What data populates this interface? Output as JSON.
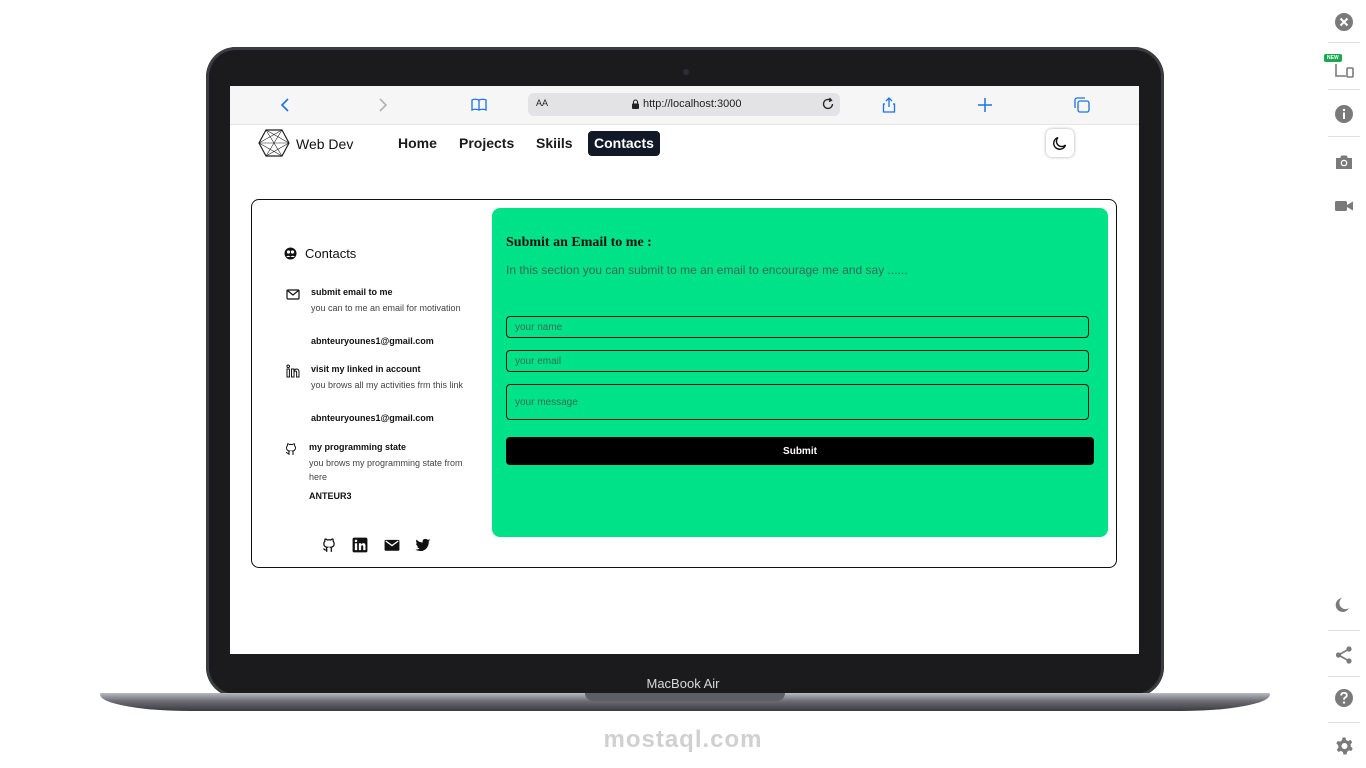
{
  "browser": {
    "url_aa": "AA",
    "url": "http://localhost:3000"
  },
  "site": {
    "brand": "Web Dev",
    "nav": [
      "Home",
      "Projects",
      "Skiils",
      "Contacts"
    ],
    "active_nav": "Contacts"
  },
  "contacts": {
    "heading": "Contacts",
    "items": [
      {
        "title": "submit email to me",
        "desc": "you can to me an email for motivation",
        "value": "abnteuryounes1@gmail.com",
        "icon": "mail-icon"
      },
      {
        "title": "visit my linked in account",
        "desc": "you brows all my activities frm this link",
        "value": "abnteuryounes1@gmail.com",
        "icon": "linkedin-icon"
      },
      {
        "title": "my programming state",
        "desc": "you brows my programming state from here",
        "value": "ANTEUR3",
        "icon": "github-icon"
      }
    ],
    "social_icons": [
      "github-icon",
      "linkedin-icon",
      "mail-icon",
      "twitter-icon"
    ]
  },
  "email_form": {
    "title": "Submit an Email to me :",
    "subtitle": "In this section you can submit to me an email to encourage me and say ......",
    "name_placeholder": "your name",
    "email_placeholder": "your email",
    "message_placeholder": "your message",
    "submit_label": "Submit"
  },
  "device": {
    "label": "MacBook Air"
  },
  "watermark": {
    "text": "mostaql.com"
  },
  "side_toolbar": {
    "new_badge": "NEW",
    "icons": [
      "close-icon",
      "responsive-icon",
      "info-icon",
      "camera-icon",
      "video-icon",
      "moon-icon",
      "share-icon",
      "help-icon",
      "settings-icon"
    ]
  },
  "colors": {
    "panel_green": "#00e287",
    "nav_active": "#111827",
    "accent_blue": "#1a73e8"
  }
}
